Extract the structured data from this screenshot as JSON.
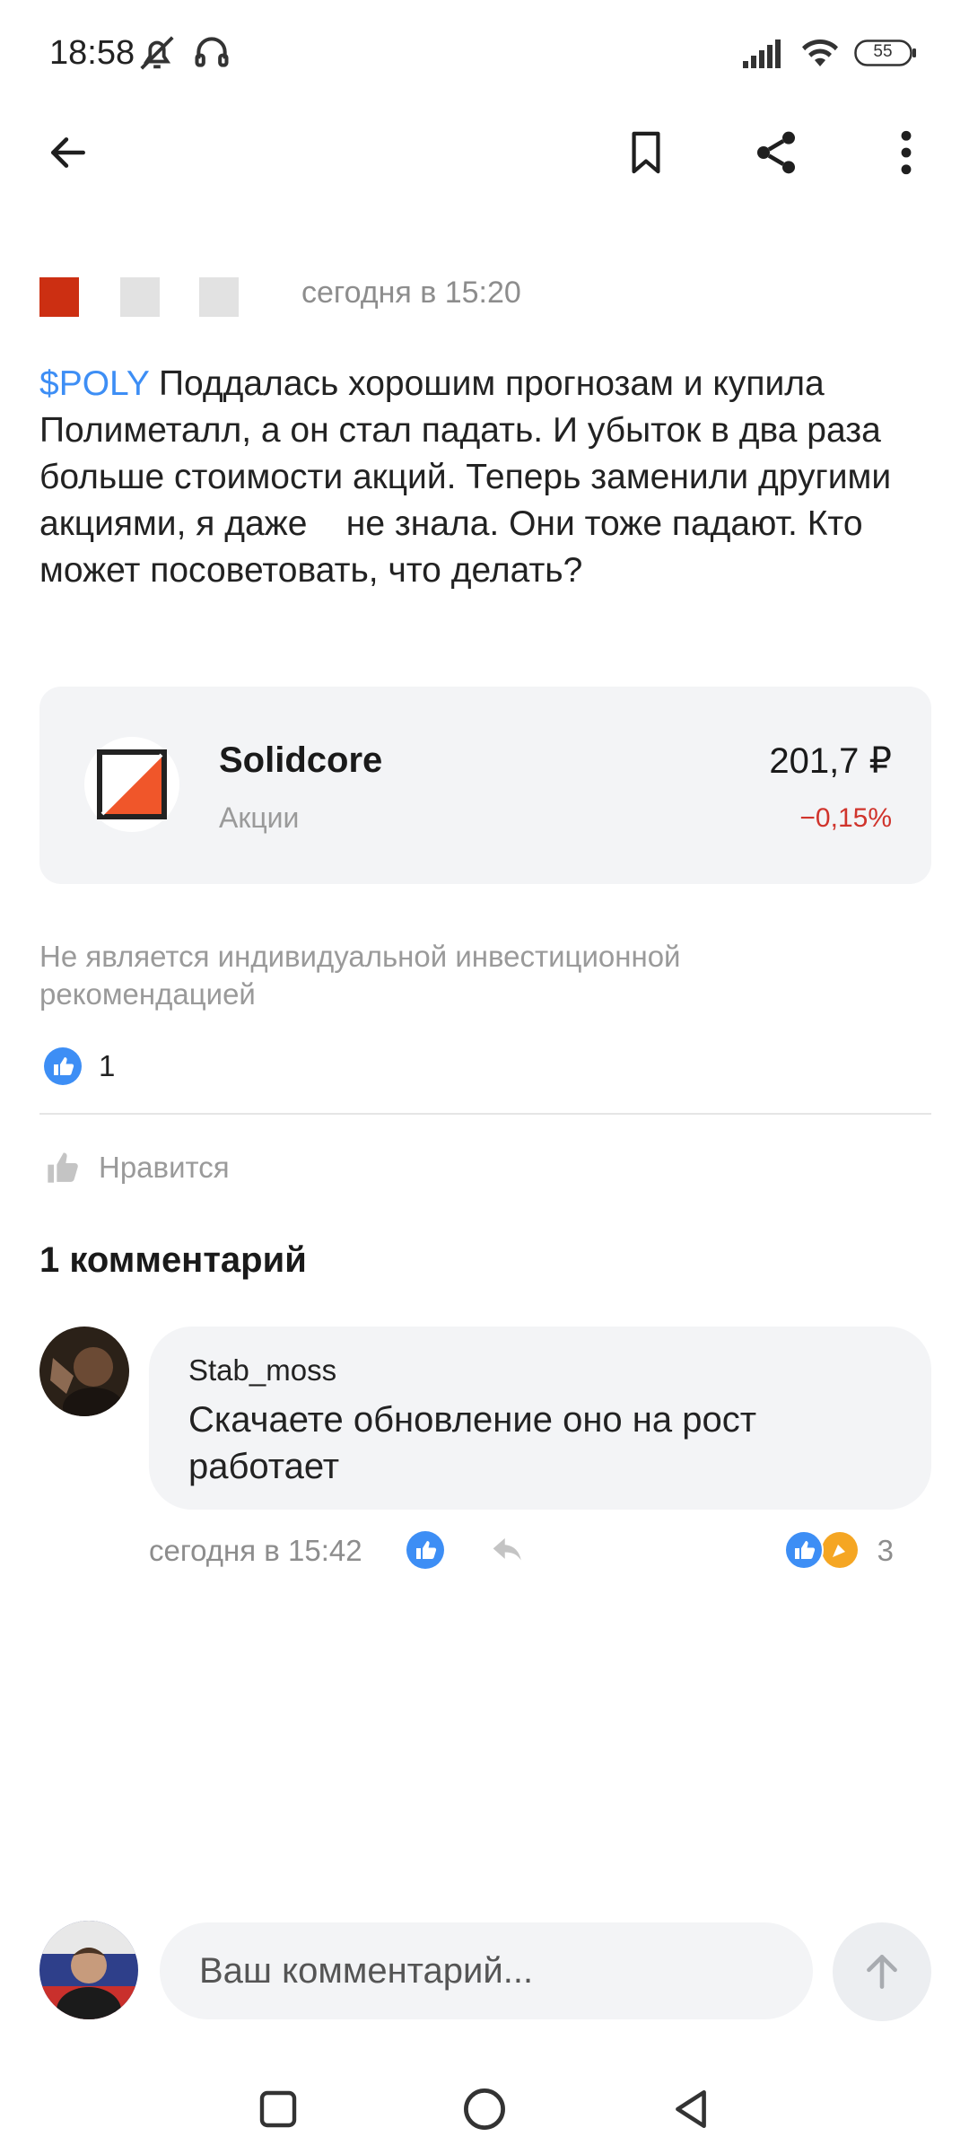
{
  "status_bar": {
    "time": "18:58",
    "battery": "55",
    "icons": [
      "bell-off-icon",
      "headphones-icon",
      "signal-icon",
      "wifi-icon",
      "battery-icon"
    ]
  },
  "app_bar": {
    "icons": [
      "back-arrow-icon",
      "bookmark-icon",
      "share-icon",
      "more-vertical-icon"
    ]
  },
  "post": {
    "time": "сегодня в 15:20",
    "ticker": "$POLY",
    "text": " Поддалась хорошим прогнозам и купила Полиметалл, а он стал падать. И убыток в два раза больше стоимости акций. Теперь заменили другими акциями, я даже    не знала. Они тоже падают. Кто может посоветовать, что делать?",
    "instrument": {
      "name": "Solidcore",
      "type": "Акции",
      "price": "201,7 ₽",
      "change": "−0,15%"
    },
    "disclaimer": "Не является индивидуальной инвестиционной рекомендацией",
    "reactions_count": "1",
    "like_label": "Нравится"
  },
  "comments": {
    "title": "1 комментарий",
    "items": [
      {
        "author": "Stab_moss",
        "text": "Скачаете обновление оно на рост работает",
        "time": "сегодня в 15:42",
        "reactions_count": "3"
      }
    ]
  },
  "composer": {
    "placeholder": "Ваш комментарий..."
  },
  "colors": {
    "accent": "#3d8ef5",
    "negative": "#d0342c",
    "card_bg": "#f3f4f6",
    "logo_orange": "#f0562a",
    "avatar_red": "#cc2f12"
  }
}
